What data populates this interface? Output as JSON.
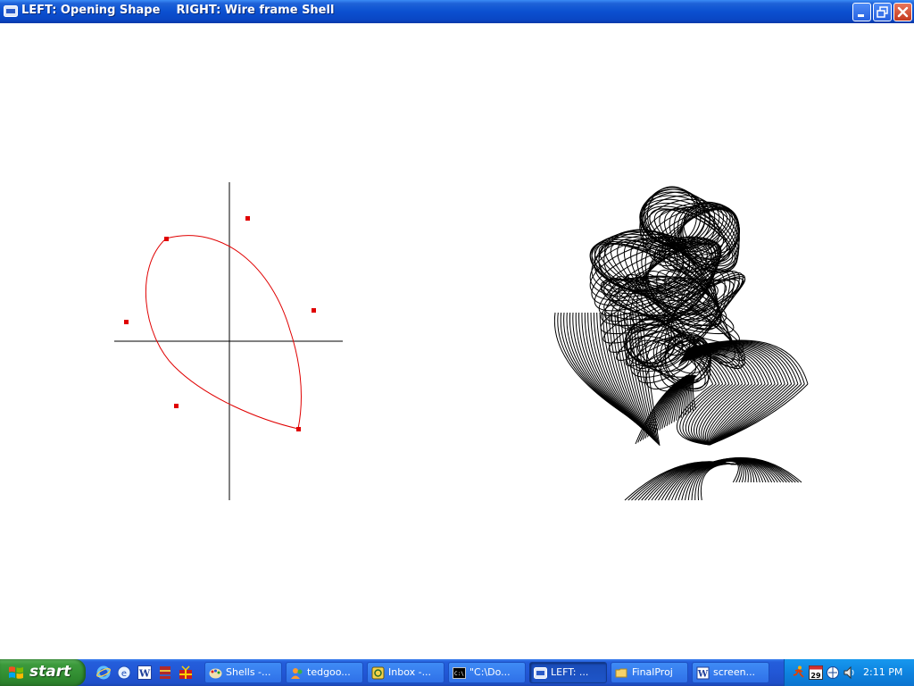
{
  "window": {
    "title": "LEFT: Opening Shape    RIGHT: Wire frame Shell"
  },
  "colors": {
    "title_bar": "#0b50d0",
    "curve": "#e00000",
    "control_points": "#e00000",
    "axes": "#000000",
    "wireframe": "#000000",
    "canvas_bg": "#ffffff",
    "taskbar": "#245edb",
    "start_button": "#3c9a3c"
  },
  "icons": {
    "window": "app-window-icon",
    "minimize": "minimize-icon",
    "maximize": "restore-icon",
    "close": "close-icon"
  },
  "taskbar": {
    "start_label": "start",
    "quick_launch": [
      "internet-explorer-icon",
      "outlook-express-icon",
      "word-icon",
      "winrar-icon",
      "gift-icon"
    ],
    "tasks": [
      {
        "label": "Shells -...",
        "icon": "paint-icon",
        "active": false
      },
      {
        "label": "tedgoo...",
        "icon": "messenger-icon",
        "active": false
      },
      {
        "label": "Inbox -...",
        "icon": "email-icon",
        "active": false
      },
      {
        "label": "\"C:\\Do...",
        "icon": "console-icon",
        "active": false
      },
      {
        "label": "LEFT: ...",
        "icon": "app-window-icon",
        "active": true
      },
      {
        "label": "FinalProj",
        "icon": "folder-icon",
        "active": false
      },
      {
        "label": "screen...",
        "icon": "word-document-icon",
        "active": false
      }
    ],
    "tray": {
      "icons": [
        "running-man-icon",
        "calendar-icon",
        "network-icon",
        "volume-icon"
      ],
      "calendar_day": "29",
      "clock": "2:11 PM"
    }
  }
}
